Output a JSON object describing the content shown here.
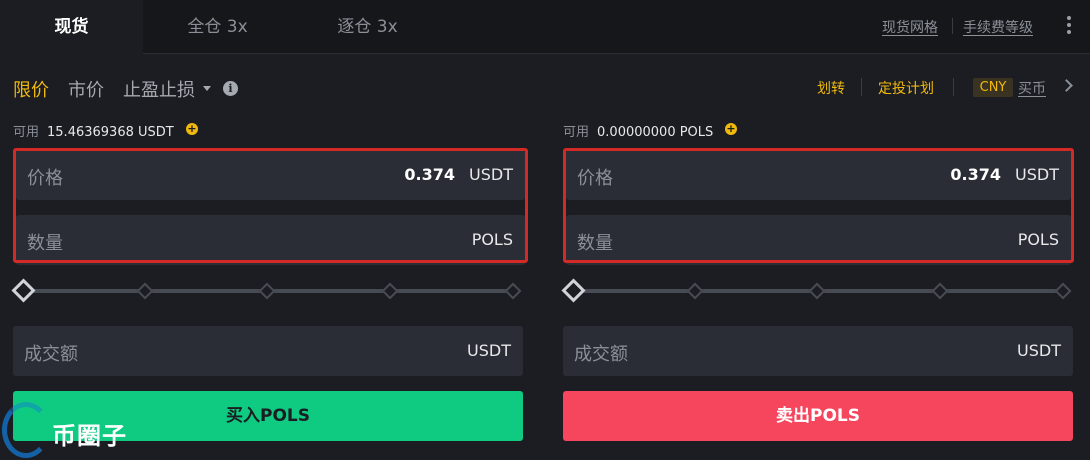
{
  "tabs": {
    "spot": "现货",
    "cross": "全仓 3x",
    "isolated": "逐仓 3x"
  },
  "top_links": {
    "spot_grid": "现货网格",
    "fee_level": "手续费等级"
  },
  "order_types": {
    "limit": "限价",
    "market": "市价",
    "tp_sl": "止盈止损"
  },
  "right_links": {
    "transfer": "划转",
    "auto_invest": "定投计划",
    "currency": "CNY",
    "buy_crypto": "买币"
  },
  "buy": {
    "available_label": "可用",
    "available_value": "15.46369368 USDT",
    "price_label": "价格",
    "price_value": "0.374",
    "price_unit": "USDT",
    "amount_label": "数量",
    "amount_unit": "POLS",
    "total_label": "成交额",
    "total_unit": "USDT",
    "button": "买入POLS"
  },
  "sell": {
    "available_label": "可用",
    "available_value": "0.00000000 POLS",
    "price_label": "价格",
    "price_value": "0.374",
    "price_unit": "USDT",
    "amount_label": "数量",
    "amount_unit": "POLS",
    "total_label": "成交额",
    "total_unit": "USDT",
    "button": "卖出POLS"
  },
  "slider": {
    "buy_percent": 0,
    "sell_percent": 0
  },
  "watermark": {
    "text": "币圈子"
  },
  "colors": {
    "accent": "#f0b90b",
    "buy": "#0ecb81",
    "sell": "#f6465d",
    "highlight_frame": "#d42a25"
  }
}
